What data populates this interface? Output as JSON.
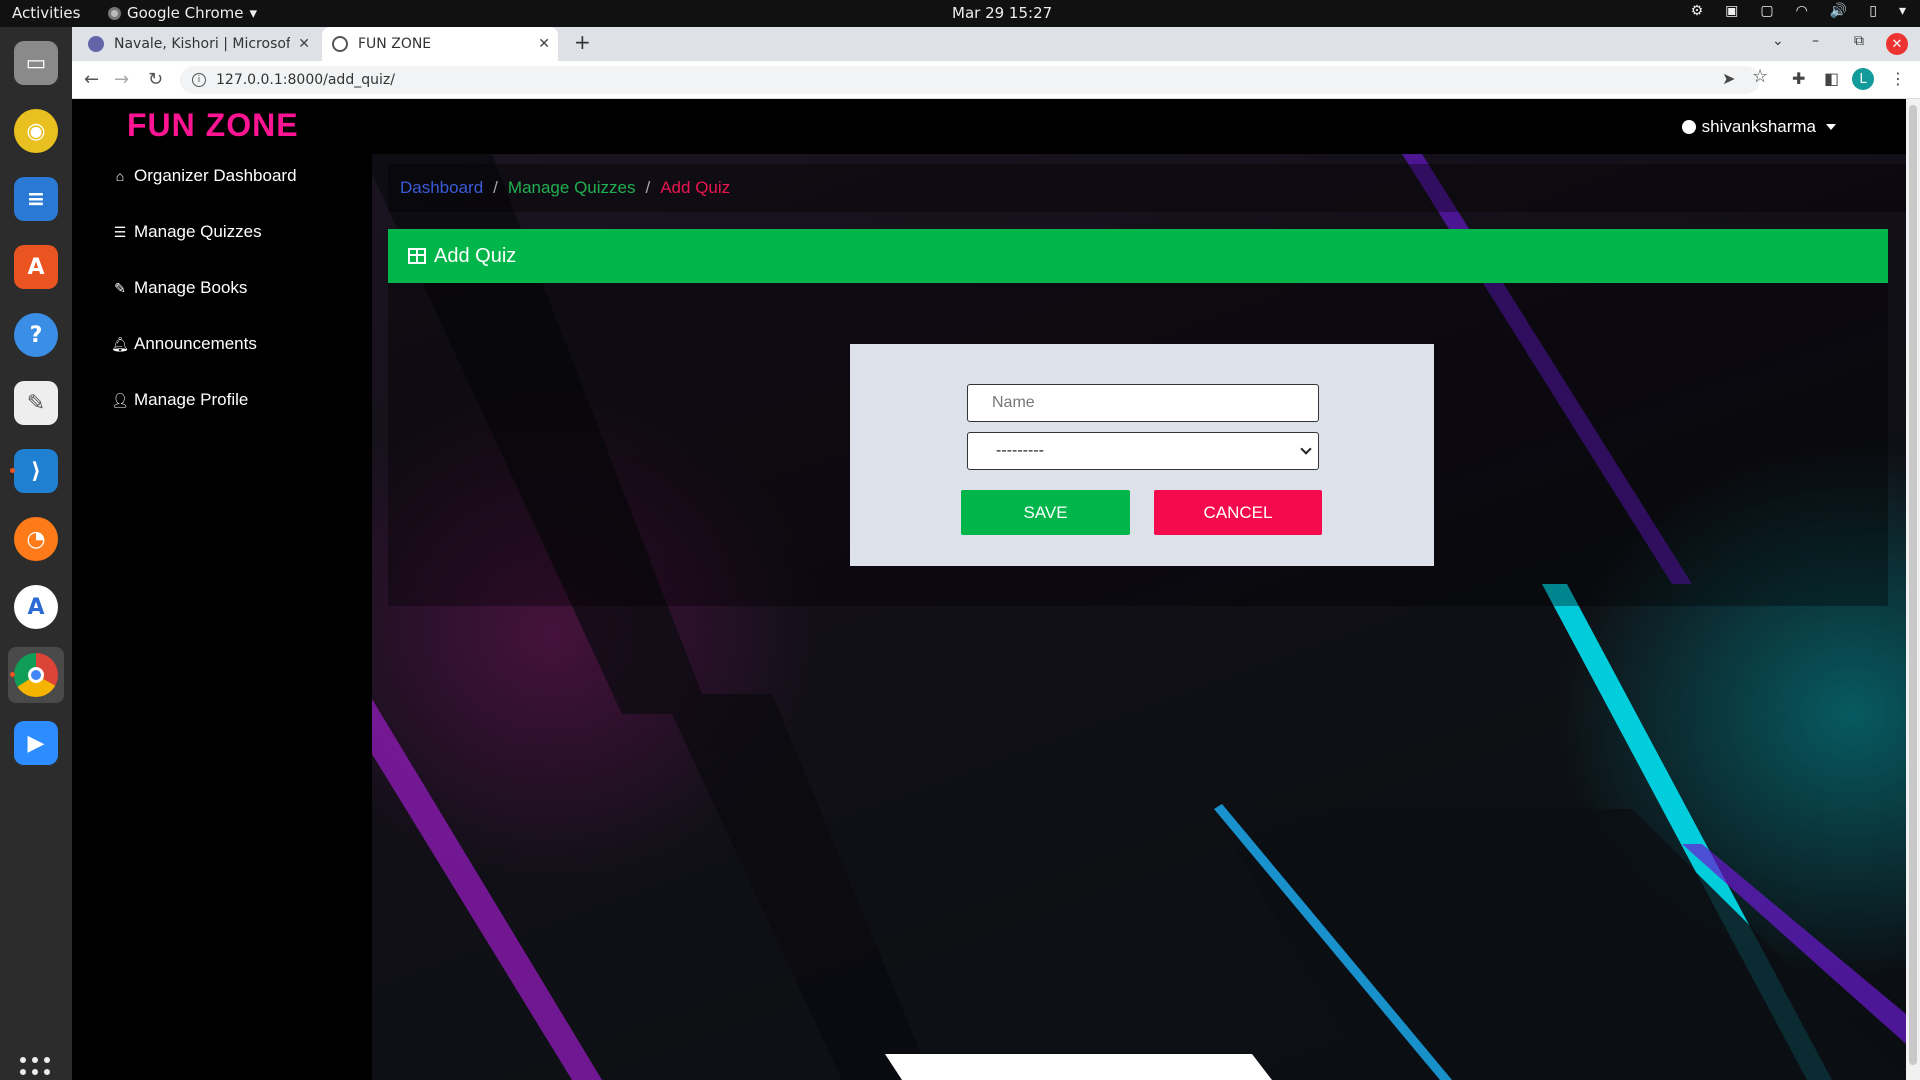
{
  "desktop": {
    "activities": "Activities",
    "app_name": "Google Chrome",
    "clock": "Mar 29  15:27"
  },
  "browser": {
    "tabs": [
      {
        "title": "Navale, Kishori | Microsof"
      },
      {
        "title": "FUN ZONE"
      }
    ],
    "url": "127.0.0.1:8000/add_quiz/",
    "profile_initial": "L"
  },
  "site": {
    "brand": "FUN ZONE",
    "username": "shivanksharma",
    "sidebar": [
      {
        "label": "Organizer Dashboard",
        "icon": "home-icon"
      },
      {
        "label": "Manage Quizzes",
        "icon": "list-icon"
      },
      {
        "label": "Manage Books",
        "icon": "pencil-icon"
      },
      {
        "label": "Announcements",
        "icon": "bell-icon"
      },
      {
        "label": "Manage Profile",
        "icon": "user-icon"
      }
    ],
    "breadcrumb": [
      "Dashboard",
      "Manage Quizzes",
      "Add Quiz"
    ],
    "breadcrumb_sep": "/",
    "card_title": "Add Quiz",
    "form": {
      "name_placeholder": "Name",
      "select_value": "---------",
      "save_label": "SAVE",
      "cancel_label": "CANCEL"
    }
  },
  "colors": {
    "brand": "#ff1493",
    "header_green": "#00b64a",
    "cancel_red": "#f50a4d",
    "breadcrumb_dashboard": "#3a5bd9",
    "breadcrumb_manage": "#20b050",
    "breadcrumb_active": "#e8174f"
  }
}
